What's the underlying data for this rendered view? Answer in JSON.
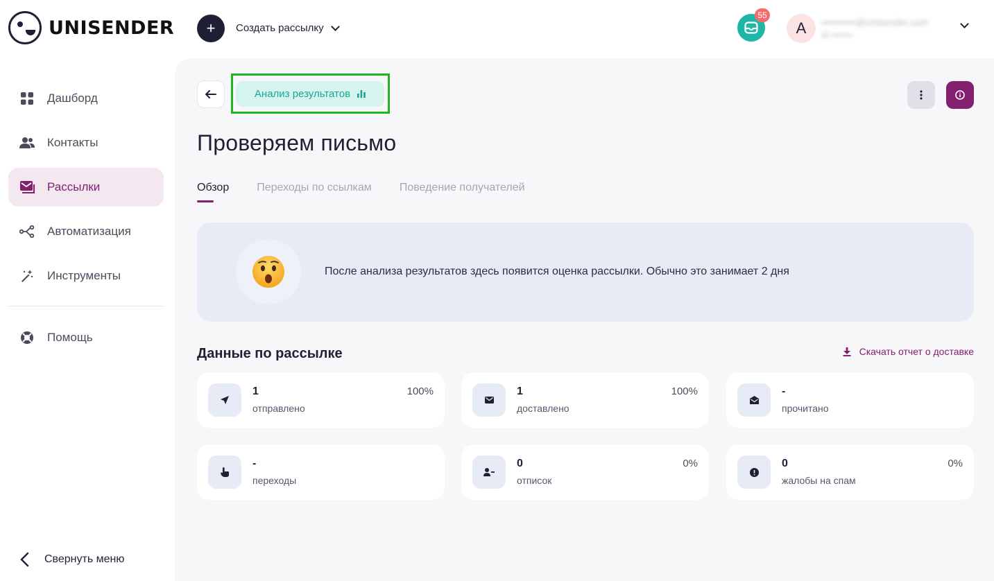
{
  "brand": {
    "name": "UNISENDER"
  },
  "header": {
    "create_icon": "plus-icon",
    "create_label": "Создать рассылку",
    "inbox_badge": "55",
    "avatar_letter": "А",
    "account_email": "••••••••••@unisender.com",
    "account_id": "ID •••••••"
  },
  "sidebar": {
    "items": [
      {
        "label": "Дашборд",
        "icon": "dashboard-icon"
      },
      {
        "label": "Контакты",
        "icon": "contacts-icon"
      },
      {
        "label": "Рассылки",
        "icon": "mail-icon",
        "active": true
      },
      {
        "label": "Автоматизация",
        "icon": "automation-icon"
      },
      {
        "label": "Инструменты",
        "icon": "magic-wand-icon"
      },
      {
        "label": "Помощь",
        "icon": "lifebuoy-icon"
      }
    ],
    "collapse_label": "Свернуть меню"
  },
  "main": {
    "status_chip": "Анализ результатов",
    "title": "Проверяем письмо",
    "tabs": [
      "Обзор",
      "Переходы по ссылкам",
      "Поведение получателей"
    ],
    "notice_text": "После анализа результатов здесь появится оценка рассылки. Обычно это занимает 2 дня",
    "section_title": "Данные по рассылке",
    "download_label": "Скачать отчет о доставке",
    "stats": [
      {
        "value": "1",
        "label": "отправлено",
        "pct": "100%",
        "icon": "send-icon"
      },
      {
        "value": "1",
        "label": "доставлено",
        "pct": "100%",
        "icon": "envelope-icon"
      },
      {
        "value": "-",
        "label": "прочитано",
        "pct": "",
        "icon": "open-envelope-icon"
      },
      {
        "value": "-",
        "label": "переходы",
        "pct": "",
        "icon": "pointer-hand-icon"
      },
      {
        "value": "0",
        "label": "отписок",
        "pct": "0%",
        "icon": "user-minus-icon"
      },
      {
        "value": "0",
        "label": "жалобы на спам",
        "pct": "0%",
        "icon": "alert-icon"
      }
    ]
  },
  "colors": {
    "accent": "#82206f",
    "teal": "#1fb6a5",
    "highlight_frame": "#22b41e"
  }
}
